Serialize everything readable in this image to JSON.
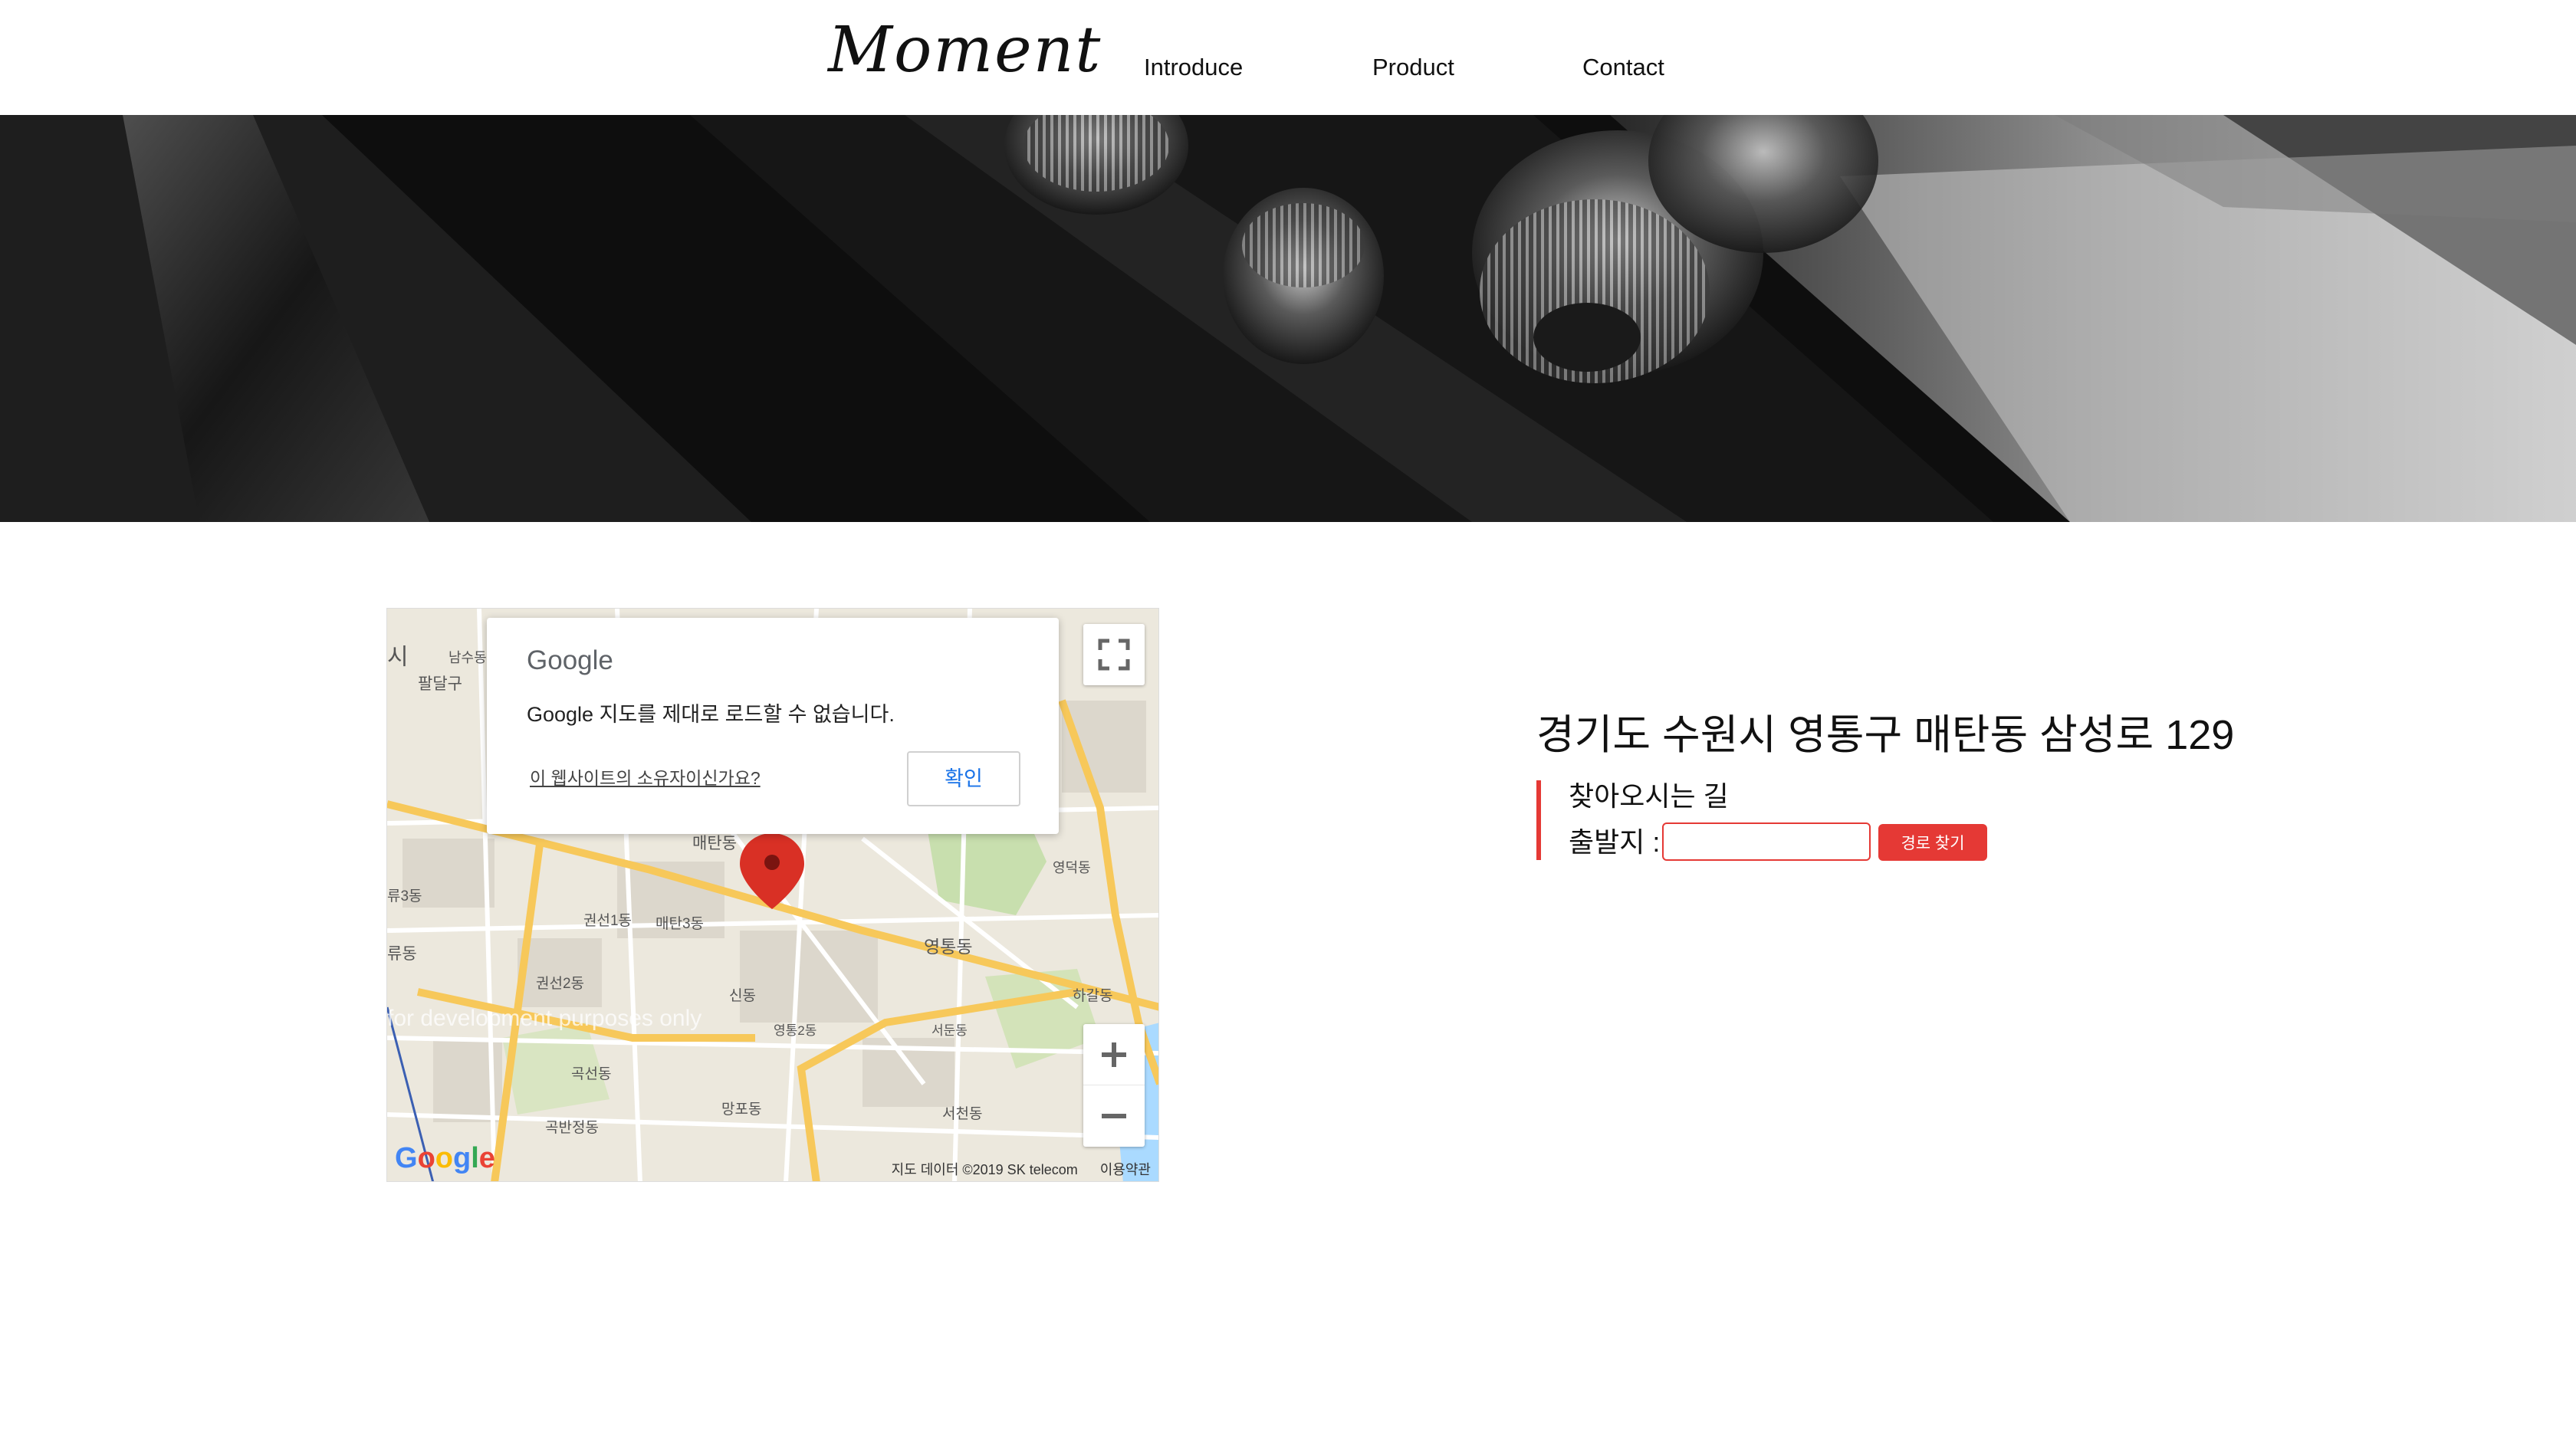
{
  "header": {
    "logo": "Moment",
    "nav": [
      "Introduce",
      "Product",
      "Contact"
    ]
  },
  "map": {
    "dialog": {
      "logo": "Google",
      "message": "Google 지도를 제대로 로드할 수 없습니다.",
      "owner_link": "이 웹사이트의 소유자이신가요?",
      "ok_button": "확인"
    },
    "labels": [
      "시",
      "팔달구",
      "남수동",
      "매탄동",
      "영덕동",
      "권선1동",
      "매탄3동",
      "류3동",
      "영통동",
      "류동",
      "권선2동",
      "신동",
      "하갈동",
      "영통2동",
      "서둔동",
      "곡선동",
      "망포동",
      "서천동",
      "곡반정동"
    ],
    "watermark": "for development purposes only",
    "google_logo": "Google",
    "attribution": "지도 데이터 ©2019 SK telecom",
    "terms": "이용약관"
  },
  "info": {
    "address": "경기도 수원시 영통구 매탄동 삼성로 129",
    "directions_title": "찾아오시는 길",
    "origin_label": "출발지 :",
    "origin_value": "",
    "route_button": "경로 찾기"
  },
  "colors": {
    "accent": "#e53935",
    "map_pin": "#d93025",
    "map_background": "#ece8dd"
  }
}
